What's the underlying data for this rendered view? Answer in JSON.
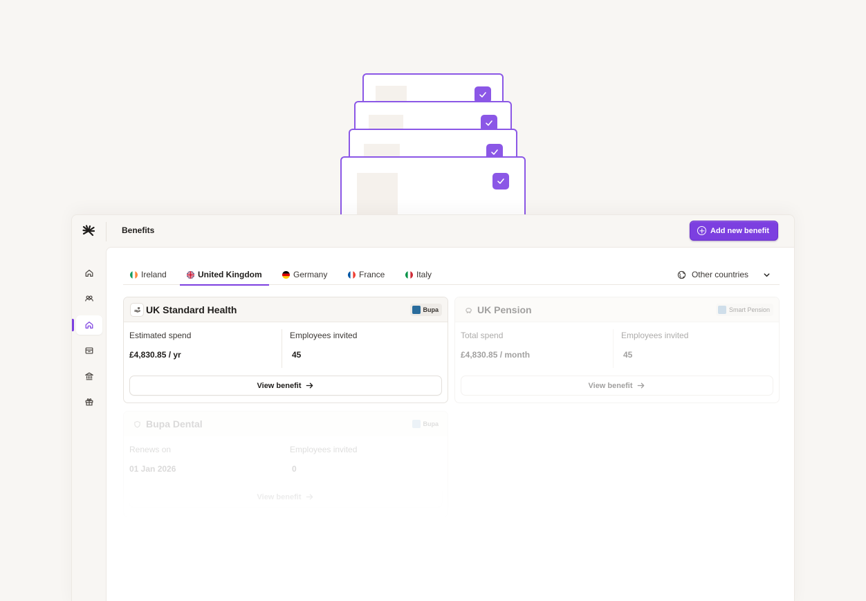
{
  "app": {
    "page_title": "Benefits",
    "add_button_label": "Add new benefit"
  },
  "colors": {
    "accent": "#7c3fe0",
    "background": "#f8f6f3",
    "bupa_swatch": "#2a6c9c"
  },
  "sidebar": {
    "items": [
      {
        "name": "home-icon",
        "active": false
      },
      {
        "name": "people-icon",
        "active": false
      },
      {
        "name": "benefits-home-icon",
        "active": true
      },
      {
        "name": "inbox-icon",
        "active": false
      },
      {
        "name": "bank-icon",
        "active": false
      },
      {
        "name": "gift-icon",
        "active": false
      }
    ]
  },
  "tabs": [
    {
      "label": "Ireland",
      "flag": "ireland-flag-icon",
      "active": false
    },
    {
      "label": "United Kingdom",
      "flag": "uk-flag-icon",
      "active": true
    },
    {
      "label": "Germany",
      "flag": "germany-flag-icon",
      "active": false
    },
    {
      "label": "France",
      "flag": "france-flag-icon",
      "active": false
    },
    {
      "label": "Italy",
      "flag": "italy-flag-icon",
      "active": false
    }
  ],
  "other_countries_label": "Other countries",
  "benefits": [
    {
      "title": "UK Standard Health",
      "provider": "Bupa",
      "stat1_label": "Estimated spend",
      "stat1_value": "£4,830.85 / yr",
      "stat2_label": "Employees invited",
      "stat2_value": "45",
      "button_label": "View benefit"
    },
    {
      "title": "UK Pension",
      "provider": "Smart Pension",
      "stat1_label": "Total spend",
      "stat1_value": "£4,830.85 / month",
      "stat2_label": "Employees invited",
      "stat2_value": "45",
      "button_label": "View benefit"
    },
    {
      "title": "Bupa Dental",
      "provider": "Bupa",
      "stat1_label": "Renews on",
      "stat1_value": "01 Jan 2026",
      "stat2_label": "Employees invited",
      "stat2_value": "0",
      "button_label": "View benefit"
    }
  ]
}
